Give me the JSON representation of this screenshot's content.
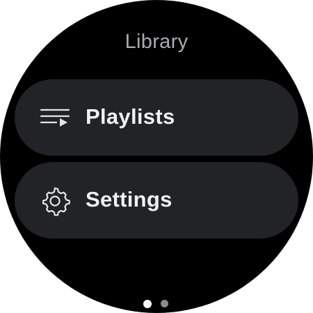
{
  "header": {
    "title": "Library"
  },
  "menu": {
    "items": [
      {
        "label": "Playlists",
        "icon": "playlist-play-icon"
      },
      {
        "label": "Settings",
        "icon": "gear-icon"
      }
    ]
  },
  "pager": {
    "page_count": 2,
    "active_page": 1
  },
  "colors": {
    "background": "#000000",
    "chip": "#222326",
    "title_text": "#a9abb0",
    "label_text": "#f1f1f3",
    "dot_active": "#ffffff",
    "dot_inactive": "#8a8b8f"
  }
}
